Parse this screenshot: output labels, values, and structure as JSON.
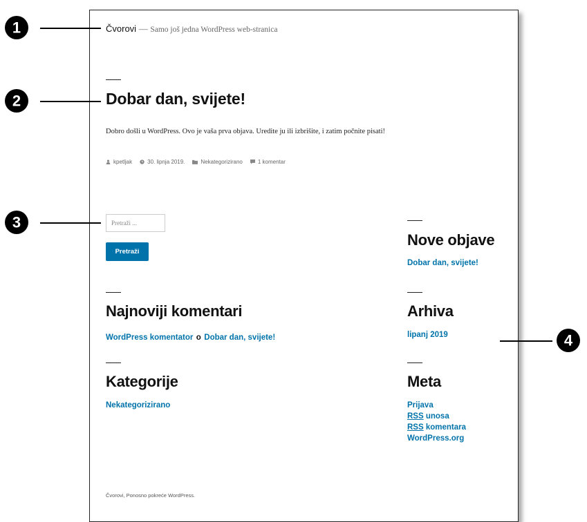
{
  "site": {
    "title": "Čvorovi",
    "separator": "—",
    "description": "Samo još jedna WordPress web-stranica"
  },
  "post": {
    "title": "Dobar dan, svijete!",
    "body": "Dobro došli u WordPress. Ovo je vaša prva objava. Uredite ju ili izbrišite, i zatim počnite pisati!",
    "meta": {
      "author": "kpetljak",
      "date": "30. lipnja 2019.",
      "category": "Nekategorizirano",
      "comments": "1 komentar"
    }
  },
  "search": {
    "placeholder": "Pretraži ...",
    "button_label": "Pretraži"
  },
  "widgets": {
    "recent_posts": {
      "heading": "Nove objave",
      "items": [
        "Dobar dan, svijete!"
      ]
    },
    "recent_comments": {
      "heading": "Najnoviji komentari",
      "author": "WordPress komentator",
      "connector": "o",
      "post": "Dobar dan, svijete!"
    },
    "archives": {
      "heading": "Arhiva",
      "items": [
        "lipanj 2019"
      ]
    },
    "categories": {
      "heading": "Kategorije",
      "items": [
        "Nekategorizirano"
      ]
    },
    "meta": {
      "heading": "Meta",
      "login": "Prijava",
      "rss_abbr": "RSS",
      "rss_entries": "unosa",
      "rss_comments": "komentara",
      "wordpress_org": "WordPress.org"
    }
  },
  "footer": {
    "site_name": "Čvorovi,",
    "credit": "Ponosno pokreće WordPress."
  },
  "callouts": [
    "1",
    "2",
    "3",
    "4"
  ],
  "colors": {
    "link": "#0073aa",
    "button": "#0073aa",
    "text": "#111111",
    "muted": "#666666",
    "callout": "#000000"
  }
}
